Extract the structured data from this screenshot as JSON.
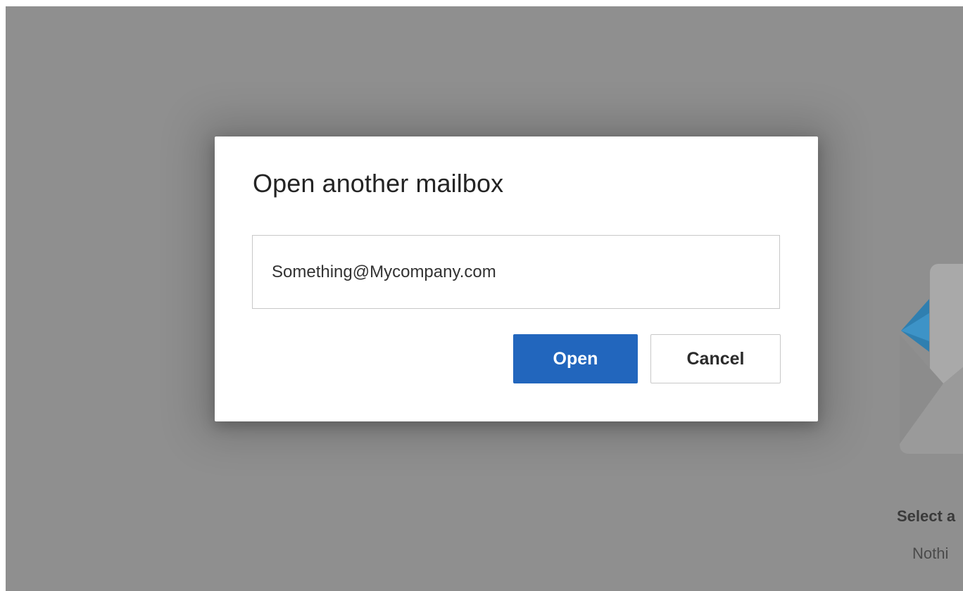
{
  "dialog": {
    "title": "Open another mailbox",
    "input": {
      "value": "Something@Mycompany.com",
      "placeholder": ""
    },
    "open_label": "Open",
    "cancel_label": "Cancel"
  },
  "reading_pane": {
    "empty_title": "Select a",
    "empty_subtitle": "Nothi",
    "illustration_icon": "open-envelope-icon"
  },
  "colors": {
    "overlay": "#8f8f8f",
    "primary": "#2266bd",
    "dialog_bg": "#ffffff"
  }
}
